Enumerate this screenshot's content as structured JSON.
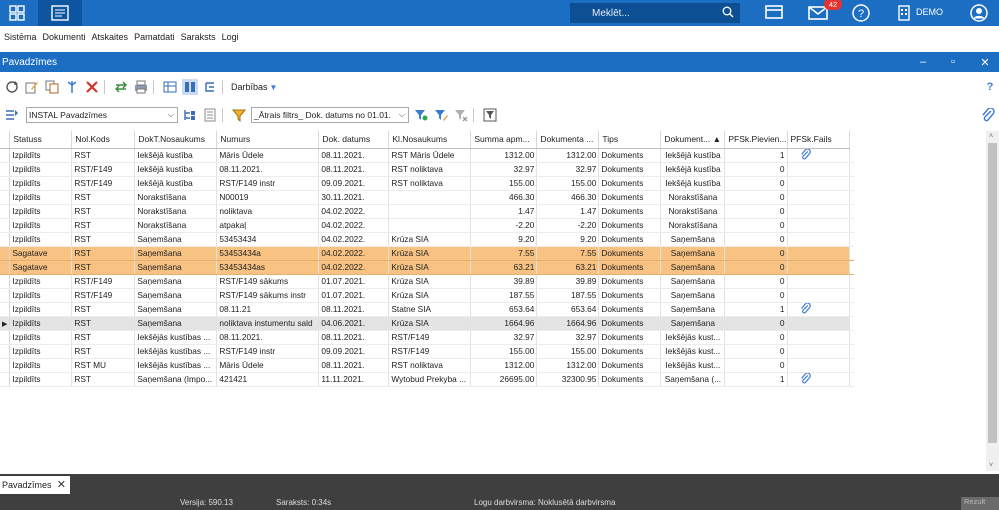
{
  "topbar": {
    "search_placeholder": "Meklēt...",
    "notification_count": "42",
    "user_label": "DEMO",
    "accent": "#1b6ec2"
  },
  "menu": [
    "Sistēma",
    "Dokumenti",
    "Atskaites",
    "Pamatdati",
    "Saraksts",
    "Logi"
  ],
  "window": {
    "title": "Pavadzīmes"
  },
  "toolbar": {
    "darbibas_label": "Darbības"
  },
  "filter": {
    "group_select": "INSTAL Pavadzīmes",
    "quick_filter": "_Ātrais filtrs_ Dok. datums no 01.01."
  },
  "grid": {
    "columns": [
      "Statuss",
      "Nol.Kods",
      "DokT.Nosaukums",
      "Numurs",
      "Dok. datums",
      "Kl.Nosaukums",
      "Summa apm...",
      "Dokumenta ...",
      "Tips",
      "Dokument... ▲",
      "PFSk.Pievien...",
      "PFSk.Fails"
    ],
    "rows": [
      {
        "statuss": "Izpildīts",
        "nol": "RST",
        "dokt": "Iekšējā kustība",
        "numurs": "Māris Ūdele",
        "datums": "08.11.2021.",
        "kl": "RST Māris Ūdele",
        "summa": "1312.00",
        "dsumma": "1312.00",
        "tips": "Dokuments",
        "dok": "Iekšējā kustība",
        "pievien": "1",
        "fails": true,
        "style": ""
      },
      {
        "statuss": "Izpildīts",
        "nol": "RST/F149",
        "dokt": "Iekšējā kustība",
        "numurs": "08.11.2021.",
        "datums": "08.11.2021.",
        "kl": "RST noliktava",
        "summa": "32.97",
        "dsumma": "32.97",
        "tips": "Dokuments",
        "dok": "Iekšējā kustība",
        "pievien": "0",
        "fails": false,
        "style": ""
      },
      {
        "statuss": "Izpildīts",
        "nol": "RST/F149",
        "dokt": "Iekšējā kustība",
        "numurs": "RST/F149 instr",
        "datums": "09.09.2021.",
        "kl": "RST noliktava",
        "summa": "155.00",
        "dsumma": "155.00",
        "tips": "Dokuments",
        "dok": "Iekšējā kustība",
        "pievien": "0",
        "fails": false,
        "style": ""
      },
      {
        "statuss": "Izpildīts",
        "nol": "RST",
        "dokt": "Norakstīšana",
        "numurs": "N00019",
        "datums": "30.11.2021.",
        "kl": "",
        "summa": "466.30",
        "dsumma": "466.30",
        "tips": "Dokuments",
        "dok": "Norakstīšana",
        "pievien": "0",
        "fails": false,
        "style": ""
      },
      {
        "statuss": "Izpildīts",
        "nol": "RST",
        "dokt": "Norakstīšana",
        "numurs": "noliktava",
        "datums": "04.02.2022.",
        "kl": "",
        "summa": "1.47",
        "dsumma": "1.47",
        "tips": "Dokuments",
        "dok": "Norakstīšana",
        "pievien": "0",
        "fails": false,
        "style": ""
      },
      {
        "statuss": "Izpildīts",
        "nol": "RST",
        "dokt": "Norakstīšana",
        "numurs": "atpakaļ",
        "datums": "04.02.2022.",
        "kl": "",
        "summa": "-2.20",
        "dsumma": "-2.20",
        "tips": "Dokuments",
        "dok": "Norakstīšana",
        "pievien": "0",
        "fails": false,
        "style": ""
      },
      {
        "statuss": "Izpildīts",
        "nol": "RST",
        "dokt": "Saņemšana",
        "numurs": "53453434",
        "datums": "04.02.2022.",
        "kl": "Krūza SIA",
        "summa": "9.20",
        "dsumma": "9.20",
        "tips": "Dokuments",
        "dok": "Saņemšana",
        "pievien": "0",
        "fails": false,
        "style": ""
      },
      {
        "statuss": "Sagatave",
        "nol": "RST",
        "dokt": "Saņemšana",
        "numurs": "53453434a",
        "datums": "04.02.2022.",
        "kl": "Krūza SIA",
        "summa": "7.55",
        "dsumma": "7.55",
        "tips": "Dokuments",
        "dok": "Saņemšana",
        "pievien": "0",
        "fails": false,
        "style": "hl"
      },
      {
        "statuss": "Sagatave",
        "nol": "RST",
        "dokt": "Saņemšana",
        "numurs": "53453434as",
        "datums": "04.02.2022.",
        "kl": "Krūza SIA",
        "summa": "63.21",
        "dsumma": "63.21",
        "tips": "Dokuments",
        "dok": "Saņemšana",
        "pievien": "0",
        "fails": false,
        "style": "hl"
      },
      {
        "statuss": "Izpildīts",
        "nol": "RST/F149",
        "dokt": "Saņemšana",
        "numurs": "RST/F149 sākums",
        "datums": "01.07.2021.",
        "kl": "Krūza SIA",
        "summa": "39.89",
        "dsumma": "39.89",
        "tips": "Dokuments",
        "dok": "Saņemšana",
        "pievien": "0",
        "fails": false,
        "style": ""
      },
      {
        "statuss": "Izpildīts",
        "nol": "RST/F149",
        "dokt": "Saņemšana",
        "numurs": "RST/F149 sākums instr",
        "datums": "01.07.2021.",
        "kl": "Krūza SIA",
        "summa": "187.55",
        "dsumma": "187.55",
        "tips": "Dokuments",
        "dok": "Saņemšana",
        "pievien": "0",
        "fails": false,
        "style": ""
      },
      {
        "statuss": "Izpildīts",
        "nol": "RST",
        "dokt": "Saņemšana",
        "numurs": "08.11.21",
        "datums": "08.11.2021.",
        "kl": "Statne SIA",
        "summa": "653.64",
        "dsumma": "653.64",
        "tips": "Dokuments",
        "dok": "Saņemšana",
        "pievien": "1",
        "fails": true,
        "style": ""
      },
      {
        "statuss": "Izpildīts",
        "nol": "RST",
        "dokt": "Saņemšana",
        "numurs": "noliktava instumentu sald",
        "datums": "04.06.2021.",
        "kl": "Krūza SIA",
        "summa": "1664.96",
        "dsumma": "1664.96",
        "tips": "Dokuments",
        "dok": "Saņemšana",
        "pievien": "0",
        "fails": false,
        "style": "sel"
      },
      {
        "statuss": "Izpildīts",
        "nol": "RST",
        "dokt": "Iekšējās kustības ...",
        "numurs": "08.11.2021.",
        "datums": "08.11.2021.",
        "kl": "RST/F149",
        "summa": "32.97",
        "dsumma": "32.97",
        "tips": "Dokuments",
        "dok": "Iekšējās kust...",
        "pievien": "0",
        "fails": false,
        "style": ""
      },
      {
        "statuss": "Izpildīts",
        "nol": "RST",
        "dokt": "Iekšējās kustības ...",
        "numurs": "RST/F149 instr",
        "datums": "09.09.2021.",
        "kl": "RST/F149",
        "summa": "155.00",
        "dsumma": "155.00",
        "tips": "Dokuments",
        "dok": "Iekšējās kust...",
        "pievien": "0",
        "fails": false,
        "style": ""
      },
      {
        "statuss": "Izpildīts",
        "nol": "RST MU",
        "dokt": "Iekšējās kustības ...",
        "numurs": "Māris Ūdele",
        "datums": "08.11.2021.",
        "kl": "RST noliktava",
        "summa": "1312.00",
        "dsumma": "1312.00",
        "tips": "Dokuments",
        "dok": "Iekšējās kust...",
        "pievien": "0",
        "fails": false,
        "style": ""
      },
      {
        "statuss": "Izpildīts",
        "nol": "RST",
        "dokt": "Saņemšana (Impo...",
        "numurs": "421421",
        "datums": "11.11.2021.",
        "kl": "Wytobud Prekyba ...",
        "summa": "26695.00",
        "dsumma": "32300.95",
        "tips": "Dokuments",
        "dok": "Saņemšana (...",
        "pievien": "1",
        "fails": true,
        "style": ""
      }
    ]
  },
  "tabs": {
    "open_tab": "Pavadzīmes"
  },
  "status": {
    "version": "Versija: 590.13",
    "list_time": "Saraksts: 0:34s",
    "log_mode": "Logu darbvirsma: Noklusētā darbvirsma",
    "right_button": "Rezult"
  }
}
